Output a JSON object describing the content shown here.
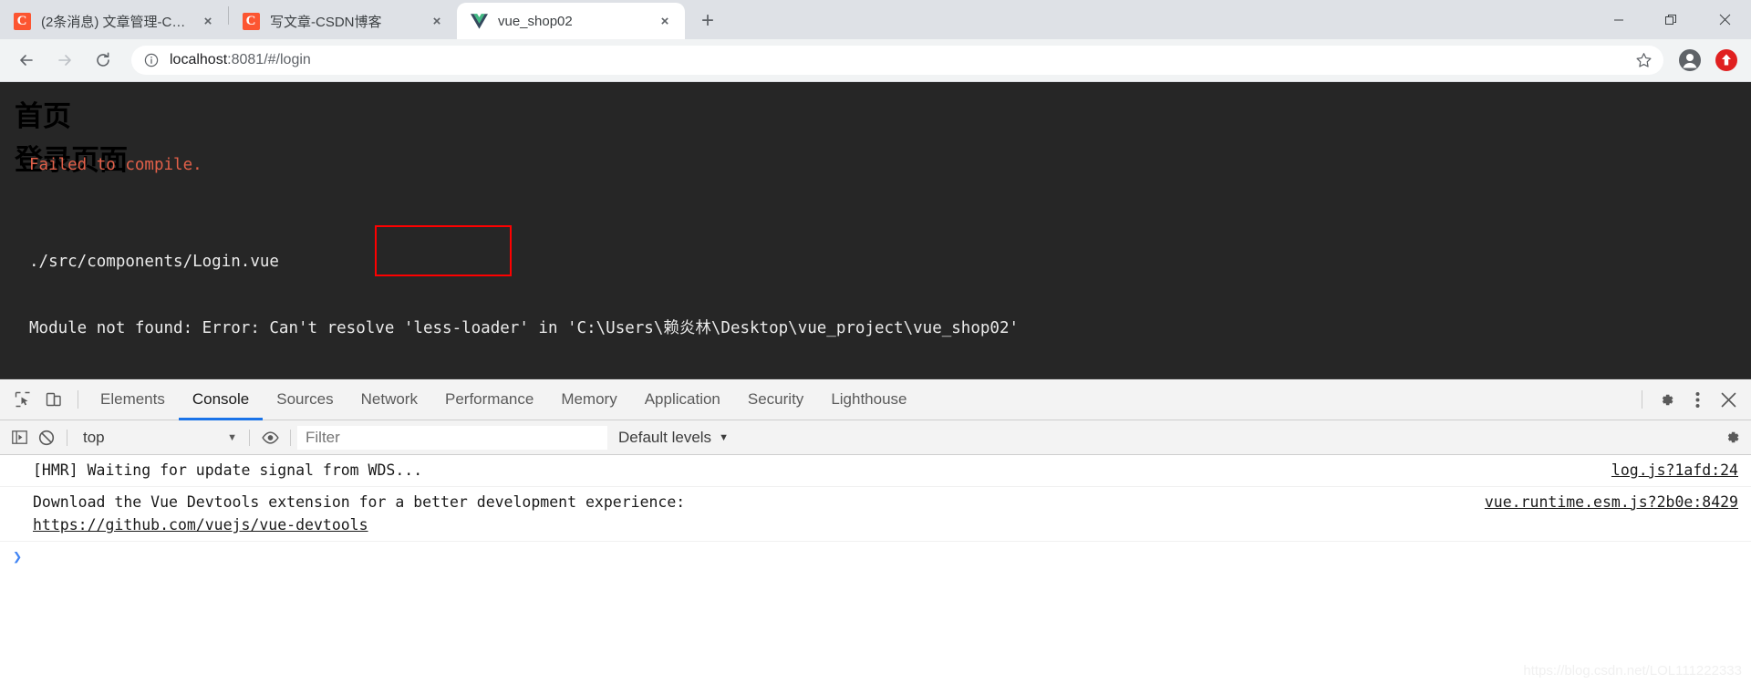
{
  "browser": {
    "tabs": [
      {
        "favicon": "csdn-icon",
        "title": "(2条消息) 文章管理-CSDN博客",
        "close": "×",
        "active": false
      },
      {
        "favicon": "csdn-icon",
        "title": "写文章-CSDN博客",
        "close": "×",
        "active": false
      },
      {
        "favicon": "vue-icon",
        "title": "vue_shop02",
        "close": "×",
        "active": true
      }
    ],
    "new_tab_label": "+",
    "window_controls": {
      "minimize": "—",
      "maximize": "❐",
      "close": "✕"
    },
    "nav": {
      "back": "←",
      "forward": "→",
      "reload": "⟳"
    },
    "omnibox": {
      "info_icon": "info-circle-icon",
      "url_host": "localhost",
      "url_path": ":8081/#/login",
      "star_icon": "star-icon",
      "profile_icon": "account-avatar-icon",
      "extension_icon": "extension-upload-icon"
    }
  },
  "page": {
    "heading_home": "首页",
    "heading_login": "登录页面",
    "error_overlay": {
      "title": "Failed to compile.",
      "file": "./src/components/Login.vue",
      "message_prefix": "Module not found: Error: Can't resolve ",
      "module": "'less-loader'",
      "message_mid": " in ",
      "path": "'C:\\Users\\赖炎林\\Desktop\\vue_project\\vue_shop02'",
      "full_line": "Module not found: Error: Can't resolve 'less-loader' in 'C:\\Users\\赖炎林\\Desktop\\vue_project\\vue_shop02'",
      "highlight_color": "#fe0000",
      "title_color": "#e36049"
    }
  },
  "devtools": {
    "inspect_icon": "inspect-cursor-icon",
    "device_toolbar_icon": "device-toggle-icon",
    "tabs": [
      {
        "label": "Elements",
        "active": false
      },
      {
        "label": "Console",
        "active": true
      },
      {
        "label": "Sources",
        "active": false
      },
      {
        "label": "Network",
        "active": false
      },
      {
        "label": "Performance",
        "active": false
      },
      {
        "label": "Memory",
        "active": false
      },
      {
        "label": "Application",
        "active": false
      },
      {
        "label": "Security",
        "active": false
      },
      {
        "label": "Lighthouse",
        "active": false
      }
    ],
    "settings_icon": "gear-icon",
    "more_icon": "kebab-menu-icon",
    "close_icon": "close-icon",
    "active_tab_underline_color": "#1a73e8",
    "console_toolbar": {
      "sidebar_icon": "console-sidebar-icon",
      "clear_icon": "clear-console-icon",
      "context": "top",
      "context_caret": "▼",
      "eye_icon": "live-expression-eye-icon",
      "filter_placeholder": "Filter",
      "filter_value": "",
      "levels_label": "Default levels",
      "levels_caret": "▼",
      "settings_icon": "console-settings-gear-icon"
    },
    "messages": [
      {
        "text": "[HMR] Waiting for update signal from WDS...",
        "source": "log.js?1afd:24",
        "link": ""
      },
      {
        "text": "Download the Vue Devtools extension for a better development experience:\n",
        "link": "https://github.com/vuejs/vue-devtools",
        "source": "vue.runtime.esm.js?2b0e:8429"
      }
    ],
    "prompt_caret": "❯",
    "prompt_value": ""
  },
  "watermark": "https://blog.csdn.net/LOL111222333"
}
